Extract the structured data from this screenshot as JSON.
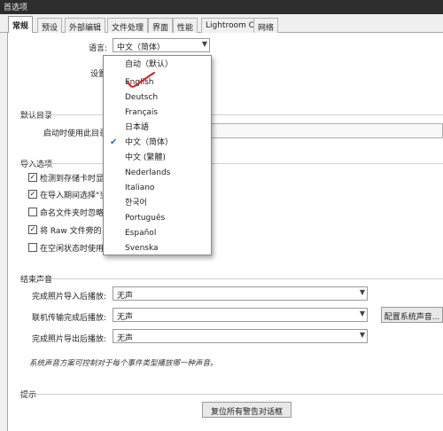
{
  "window": {
    "title": "首选项"
  },
  "tabs": [
    {
      "label": "常规"
    },
    {
      "label": "预设"
    },
    {
      "label": "外部编辑"
    },
    {
      "label": "文件处理"
    },
    {
      "label": "界面"
    },
    {
      "label": "性能"
    },
    {
      "label": "Lightroom CC"
    },
    {
      "label": "网络"
    }
  ],
  "language": {
    "label": "语言:",
    "value": "中文（简体）"
  },
  "settings_label": "设置",
  "default_catalog": {
    "title": "默认目录",
    "label": "启动时使用此目录"
  },
  "import_options": {
    "title": "导入选项",
    "items": [
      {
        "label": "检测到存储卡时显",
        "checked": true
      },
      {
        "label": "在导入期间选择\"当",
        "checked": true
      },
      {
        "label": "命名文件夹时忽略",
        "checked": false
      },
      {
        "label": "将 Raw 文件旁的",
        "checked": true
      },
      {
        "label": "在空闲状态时使用",
        "checked": false
      }
    ]
  },
  "end_sounds": {
    "title": "结束声音",
    "rows": [
      {
        "label": "完成照片导入后播放:",
        "value": "无声"
      },
      {
        "label": "联机传输完成后播放:",
        "value": "无声"
      },
      {
        "label": "完成照片导出后播放:",
        "value": "无声"
      }
    ],
    "configure_button": "配置系统声音...",
    "note": "系统声音方案可控制对于每个事件类型播放哪一种声音。"
  },
  "tips": {
    "title": "提示",
    "reset_button": "复位所有警告对话框"
  },
  "language_menu": {
    "selected_index": 5,
    "items": [
      "自动（默认）",
      "English",
      "Deutsch",
      "Français",
      "日本語",
      "中文（简体）",
      "中文 (繁體)",
      "Nederlands",
      "Italiano",
      "한국어",
      "Português",
      "Español",
      "Svenska"
    ]
  },
  "colors": {
    "accent": "#1e6fd9",
    "annotation": "#d42020"
  }
}
